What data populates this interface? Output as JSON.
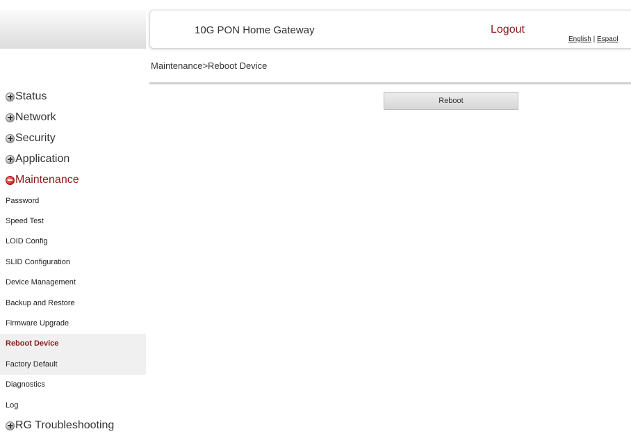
{
  "header": {
    "title": "10G PON Home Gateway",
    "logout": "Logout",
    "lang_english": "English",
    "lang_separator": " | ",
    "lang_spanish": "Espaol"
  },
  "breadcrumb": "Maintenance>Reboot Device",
  "main": {
    "reboot_button": "Reboot"
  },
  "sidebar": {
    "status": "Status",
    "network": "Network",
    "security": "Security",
    "application": "Application",
    "maintenance": "Maintenance",
    "maintenance_items": [
      "Password",
      "Speed Test",
      "LOID Config",
      "SLID Configuration",
      "Device Management",
      "Backup and Restore",
      "Firmware Upgrade",
      "Reboot Device",
      "Factory Default",
      "Diagnostics",
      "Log"
    ],
    "rg_troubleshooting": "RG Troubleshooting"
  },
  "colors": {
    "accent": "#8b1a1a",
    "active_bg": "#f0f0f0"
  },
  "icons": {
    "collapsed": "plus-circle-icon",
    "expanded": "minus-circle-icon"
  }
}
